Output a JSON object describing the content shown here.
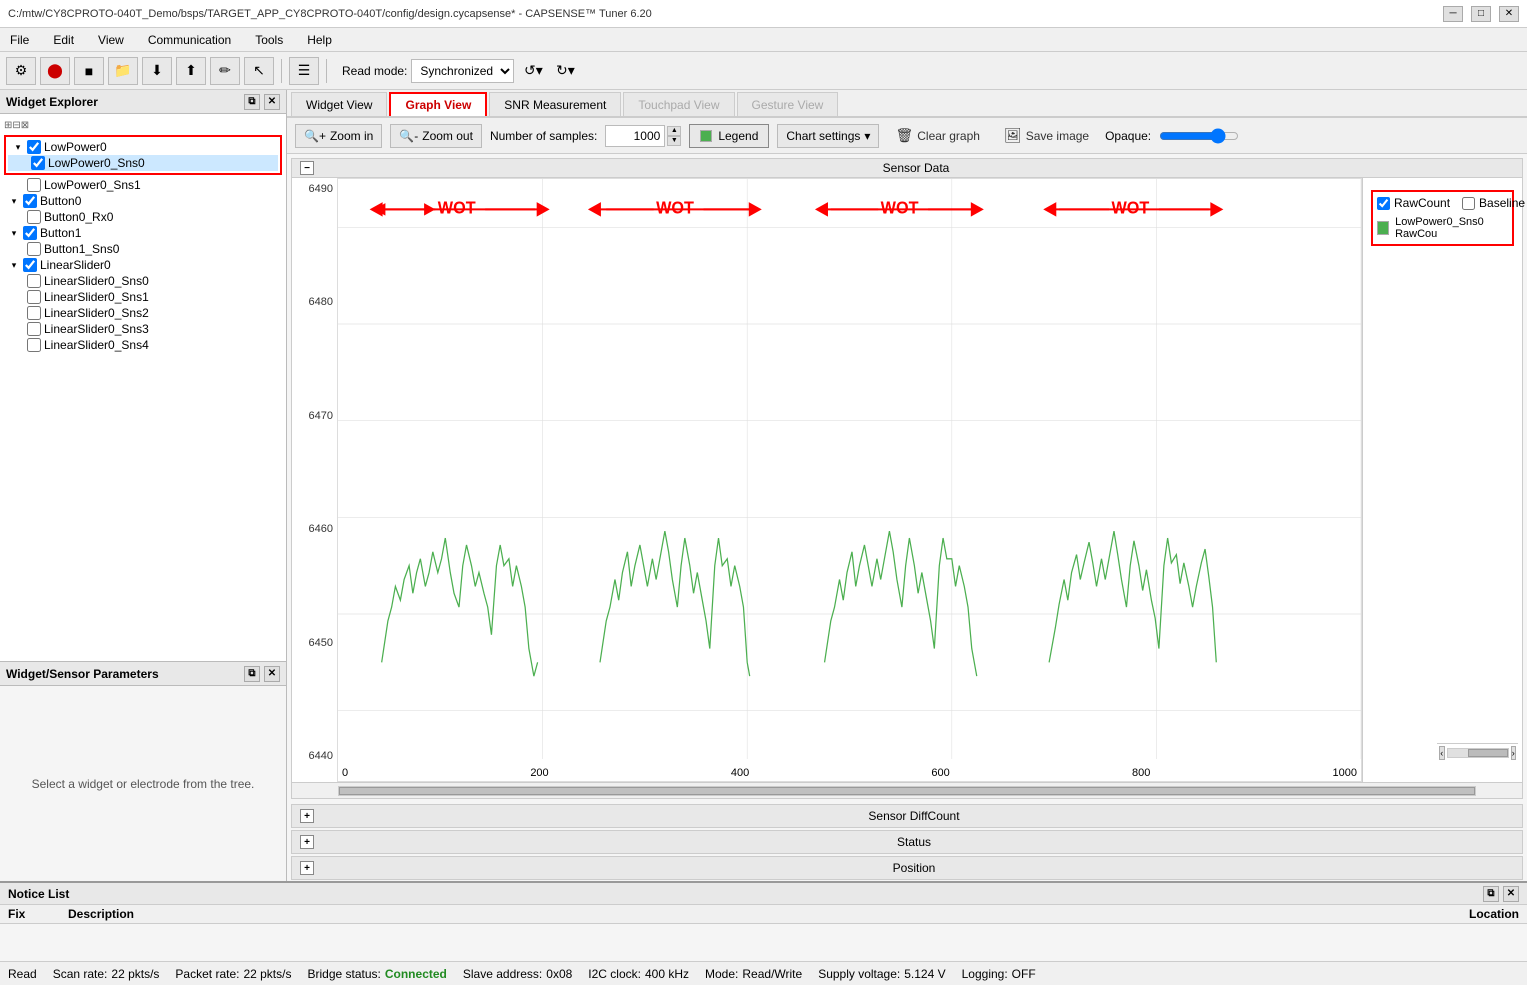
{
  "titleBar": {
    "text": "C:/mtw/CY8CPROTO-040T_Demo/bsps/TARGET_APP_CY8CPROTO-040T/config/design.cycapsense* - CAPSENSE™ Tuner 6.20",
    "minimize": "─",
    "maximize": "□",
    "close": "✕"
  },
  "menuBar": {
    "items": [
      "File",
      "Edit",
      "View",
      "Communication",
      "Tools",
      "Help"
    ]
  },
  "toolbar": {
    "readModeLabel": "Read mode:",
    "readModeValue": "Synchronized"
  },
  "tabs": [
    {
      "label": "Widget View",
      "active": false,
      "disabled": false
    },
    {
      "label": "Graph View",
      "active": true,
      "disabled": false
    },
    {
      "label": "SNR Measurement",
      "active": false,
      "disabled": false
    },
    {
      "label": "Touchpad View",
      "active": false,
      "disabled": true
    },
    {
      "label": "Gesture View",
      "active": false,
      "disabled": true
    }
  ],
  "graphToolbar": {
    "zoomIn": "Zoom in",
    "zoomOut": "Zoom out",
    "samplesLabel": "Number of samples:",
    "samplesValue": "1000",
    "legendLabel": "Legend",
    "chartSettings": "Chart settings",
    "clearGraph": "Clear graph",
    "saveImage": "Save image",
    "opaqueLabel": "Opaque:"
  },
  "widgetExplorer": {
    "title": "Widget Explorer",
    "items": [
      {
        "label": "LowPower0",
        "indent": 1,
        "checked": true,
        "expanded": true,
        "highlighted": true
      },
      {
        "label": "LowPower0_Sns0",
        "indent": 2,
        "checked": true,
        "highlighted": true
      },
      {
        "label": "LowPower0_Sns1",
        "indent": 2,
        "checked": false
      },
      {
        "label": "Button0",
        "indent": 1,
        "checked": true,
        "expanded": true
      },
      {
        "label": "Button0_Rx0",
        "indent": 2,
        "checked": false
      },
      {
        "label": "Button1",
        "indent": 1,
        "checked": true,
        "expanded": true
      },
      {
        "label": "Button1_Sns0",
        "indent": 2,
        "checked": false
      },
      {
        "label": "LinearSlider0",
        "indent": 1,
        "checked": true,
        "expanded": true
      },
      {
        "label": "LinearSlider0_Sns0",
        "indent": 2,
        "checked": false
      },
      {
        "label": "LinearSlider0_Sns1",
        "indent": 2,
        "checked": false
      },
      {
        "label": "LinearSlider0_Sns2",
        "indent": 2,
        "checked": false
      },
      {
        "label": "LinearSlider0_Sns3",
        "indent": 2,
        "checked": false
      },
      {
        "label": "LinearSlider0_Sns4",
        "indent": 2,
        "checked": false
      }
    ]
  },
  "sensorParams": {
    "title": "Widget/Sensor Parameters",
    "emptyText": "Select a widget or electrode from the tree."
  },
  "sensorData": {
    "title": "Sensor Data",
    "yAxisValues": [
      "6490",
      "6480",
      "6470",
      "6460",
      "6450",
      "6440"
    ],
    "xAxisValues": [
      "0",
      "200",
      "400",
      "600",
      "800",
      "1000"
    ],
    "wotLabels": [
      "WOT",
      "WOT",
      "WOT",
      "WOT"
    ]
  },
  "legend": {
    "rawCountLabel": "RawCount",
    "baselineLabel": "Baseline",
    "rawCountChecked": true,
    "baselineChecked": false,
    "seriesLabel": "LowPower0_Sns0 RawCou",
    "seriesColor": "#4CAF50"
  },
  "collapsibleSections": [
    {
      "label": "Sensor DiffCount"
    },
    {
      "label": "Status"
    },
    {
      "label": "Position"
    }
  ],
  "noticeList": {
    "title": "Notice List",
    "columns": {
      "fix": "Fix",
      "description": "Description",
      "location": "Location"
    }
  },
  "statusBar": {
    "readLabel": "Read",
    "scanRate": "Scan rate:",
    "scanRateValue": "22 pkts/s",
    "packetRate": "Packet rate:",
    "packetRateValue": "22 pkts/s",
    "bridgeStatus": "Bridge status:",
    "bridgeValue": "Connected",
    "slaveAddress": "Slave address:",
    "slaveAddressValue": "0x08",
    "i2cClock": "I2C clock:",
    "i2cClockValue": "400 kHz",
    "mode": "Mode:",
    "modeValue": "Read/Write",
    "supplyVoltage": "Supply voltage:",
    "supplyVoltageValue": "5.124 V",
    "logging": "Logging:",
    "loggingValue": "OFF"
  }
}
